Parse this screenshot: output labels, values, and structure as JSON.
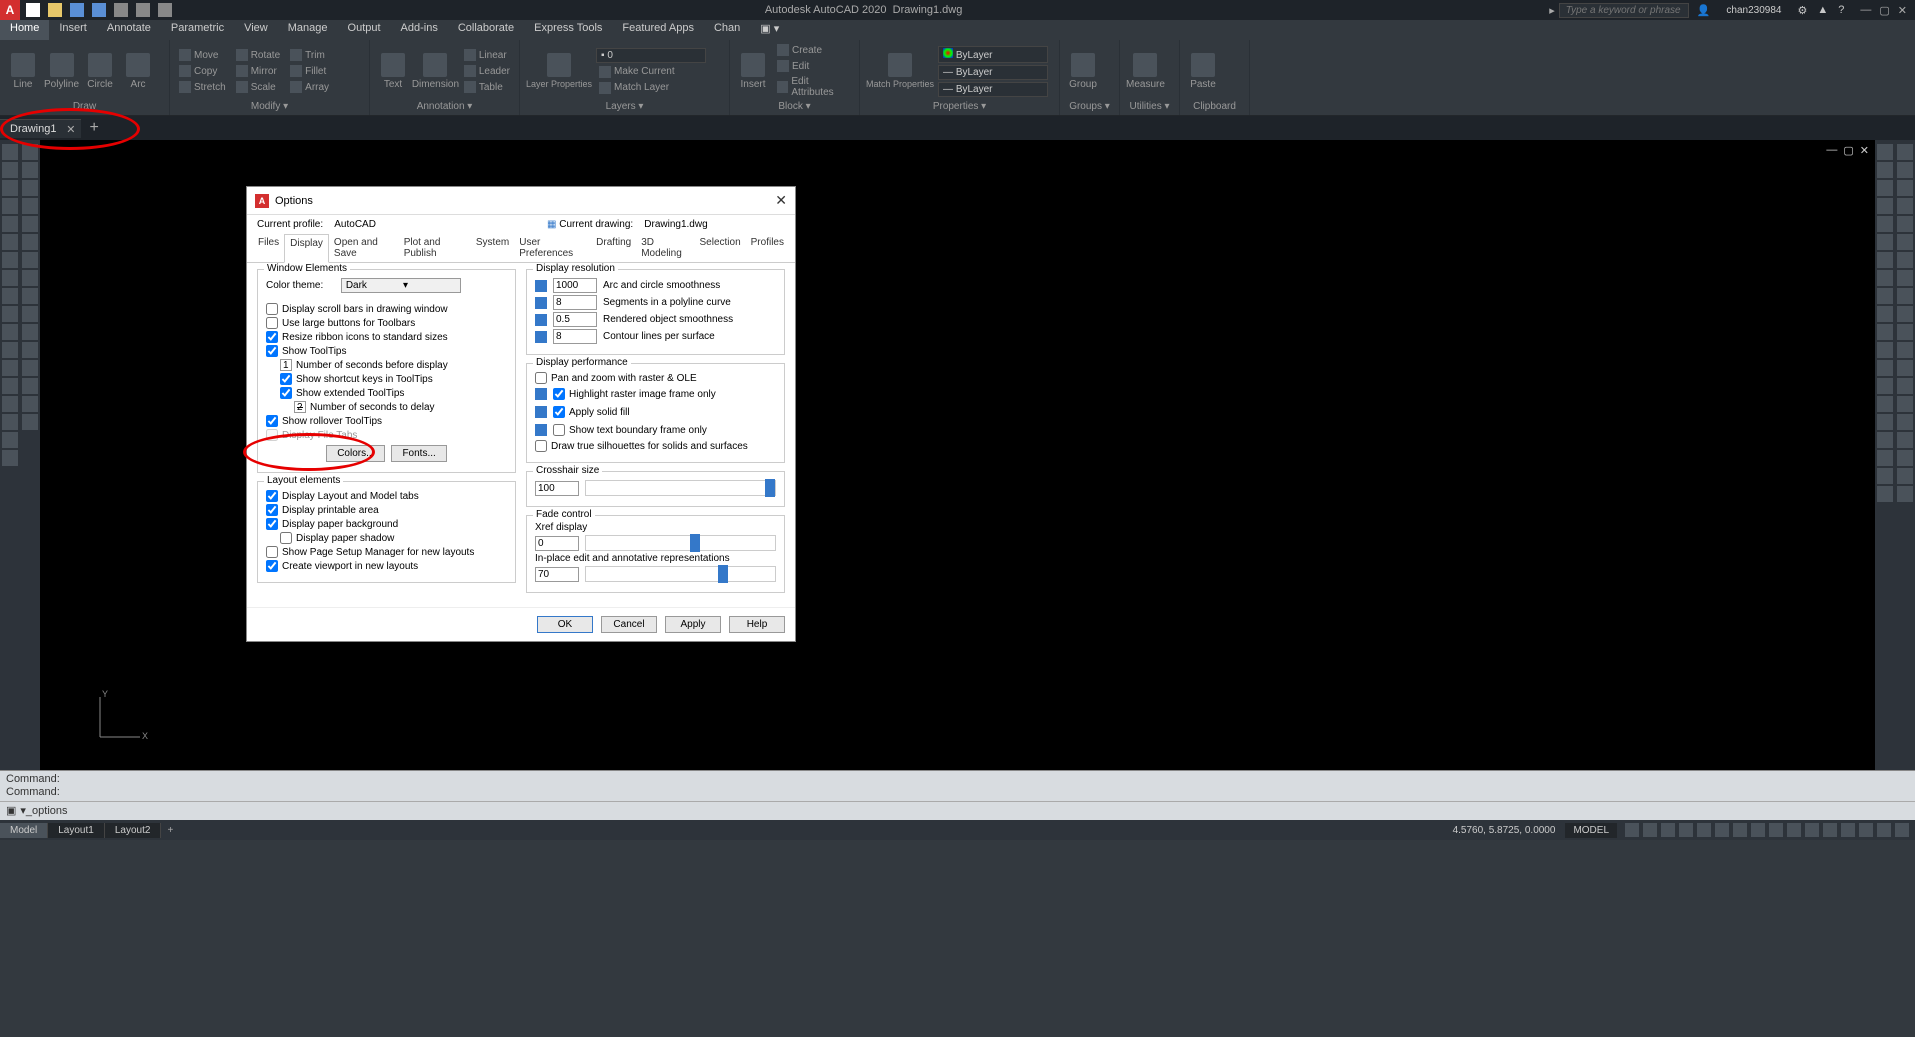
{
  "titlebar": {
    "app": "Autodesk AutoCAD 2020",
    "file": "Drawing1.dwg",
    "search_placeholder": "Type a keyword or phrase",
    "user": "chan230984"
  },
  "menutabs": [
    "Home",
    "Insert",
    "Annotate",
    "Parametric",
    "View",
    "Manage",
    "Output",
    "Add-ins",
    "Collaborate",
    "Express Tools",
    "Featured Apps",
    "Chan"
  ],
  "ribbon": {
    "draw": {
      "label": "Draw",
      "items": [
        "Line",
        "Polyline",
        "Circle",
        "Arc"
      ]
    },
    "modify": {
      "label": "Modify ▾",
      "items": [
        "Move",
        "Copy",
        "Stretch",
        "Rotate",
        "Mirror",
        "Scale",
        "Trim",
        "Fillet",
        "Array"
      ]
    },
    "annotation": {
      "label": "Annotation ▾",
      "items": [
        "Text",
        "Dimension",
        "Linear",
        "Leader",
        "Table"
      ]
    },
    "layers": {
      "label": "Layers ▾",
      "lp": "Layer Properties",
      "items": [
        "Make Current",
        "Match Layer"
      ]
    },
    "block": {
      "label": "Block ▾",
      "items": [
        "Insert",
        "Create",
        "Edit",
        "Edit Attributes"
      ]
    },
    "properties": {
      "label": "Properties ▾",
      "match": "Match Properties",
      "combo": "ByLayer",
      "bylayer": "ByLayer"
    },
    "groups": {
      "label": "Groups ▾",
      "item": "Group"
    },
    "utilities": {
      "label": "Utilities ▾",
      "item": "Measure"
    },
    "clipboard": {
      "label": "Clipboard",
      "item": "Paste"
    }
  },
  "filetab": "Drawing1",
  "dialog": {
    "title": "Options",
    "profile_label": "Current profile:",
    "profile": "AutoCAD",
    "drawing_label": "Current drawing:",
    "drawing": "Drawing1.dwg",
    "tabs": [
      "Files",
      "Display",
      "Open and Save",
      "Plot and Publish",
      "System",
      "User Preferences",
      "Drafting",
      "3D Modeling",
      "Selection",
      "Profiles"
    ],
    "window_elements": {
      "legend": "Window Elements",
      "colortheme_label": "Color theme:",
      "colortheme": "Dark",
      "scrollbars": "Display scroll bars in drawing window",
      "largebtns": "Use large buttons for Toolbars",
      "resize": "Resize ribbon icons to standard sizes",
      "tooltips": "Show ToolTips",
      "seconds": "1.000",
      "seconds_label": "Number of seconds before display",
      "shortcut": "Show shortcut keys in ToolTips",
      "extended": "Show extended ToolTips",
      "delay": "2.000",
      "delay_label": "Number of seconds to delay",
      "rollover": "Show rollover ToolTips",
      "filetabs": "Display File Tabs",
      "colors_btn": "Colors...",
      "fonts_btn": "Fonts..."
    },
    "layout_elements": {
      "legend": "Layout elements",
      "lm": "Display Layout and Model tabs",
      "pa": "Display printable area",
      "pb": "Display paper background",
      "ps": "Display paper shadow",
      "psm": "Show Page Setup Manager for new layouts",
      "cv": "Create viewport in new layouts"
    },
    "display_resolution": {
      "legend": "Display resolution",
      "arc_val": "1000",
      "arc": "Arc and circle smoothness",
      "seg_val": "8",
      "seg": "Segments in a polyline curve",
      "ren_val": "0.5",
      "ren": "Rendered object smoothness",
      "con_val": "8",
      "con": "Contour lines per surface"
    },
    "display_performance": {
      "legend": "Display performance",
      "pan": "Pan and zoom with raster & OLE",
      "hl": "Highlight raster image frame only",
      "solid": "Apply solid fill",
      "txt": "Show text boundary frame only",
      "sil": "Draw true silhouettes for solids and surfaces"
    },
    "crosshair": {
      "legend": "Crosshair size",
      "val": "100"
    },
    "fade": {
      "legend": "Fade control",
      "xref": "Xref display",
      "xref_val": "0",
      "inplace": "In-place edit and annotative representations",
      "inplace_val": "70"
    },
    "ok": "OK",
    "cancel": "Cancel",
    "apply": "Apply",
    "help": "Help"
  },
  "cmd": {
    "hist1": "Command:",
    "hist2": "Command:",
    "prompt": "▾_options"
  },
  "statusbar": {
    "tabs": [
      "Model",
      "Layout1",
      "Layout2"
    ],
    "coords": "4.5760, 5.8725, 0.0000",
    "mode": "MODEL"
  }
}
